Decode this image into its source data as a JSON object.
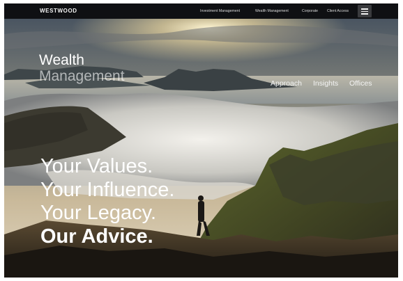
{
  "header": {
    "brand": "WESTWOOD",
    "nav": [
      "Investment Management",
      "Wealth Management",
      "Corporate",
      "Client Access"
    ],
    "menu_icon": "hamburger-menu-icon"
  },
  "hero": {
    "section_title_line1": "Wealth",
    "section_title_line2": "Management",
    "subnav": [
      "Approach",
      "Insights",
      "Offices"
    ],
    "headline": [
      "Your Values.",
      "Your Influence.",
      "Your Legacy.",
      "Our Advice."
    ]
  },
  "colors": {
    "topbar": "#0f1013",
    "menu_button": "#3a3b3e",
    "text": "#ffffff"
  }
}
